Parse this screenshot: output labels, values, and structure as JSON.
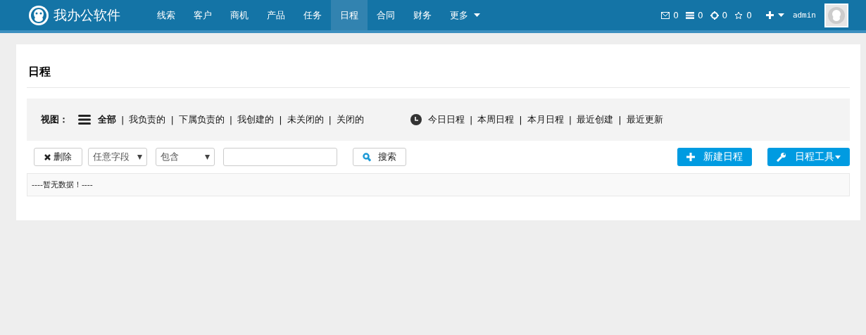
{
  "navbar": {
    "brand": "我办公软件",
    "items": [
      {
        "label": "线索",
        "selected": false
      },
      {
        "label": "客户",
        "selected": false
      },
      {
        "label": "商机",
        "selected": false
      },
      {
        "label": "产品",
        "selected": false
      },
      {
        "label": "任务",
        "selected": false
      },
      {
        "label": "日程",
        "selected": true
      },
      {
        "label": "合同",
        "selected": false
      },
      {
        "label": "财务",
        "selected": false
      },
      {
        "label": "更多",
        "selected": false,
        "dropdown": true
      }
    ],
    "counters": [
      {
        "kind": "mail",
        "count": "0"
      },
      {
        "kind": "list",
        "count": "0"
      },
      {
        "kind": "target",
        "count": "0"
      },
      {
        "kind": "star",
        "count": "0"
      }
    ],
    "user": "admin"
  },
  "page": {
    "title": "日程",
    "views": {
      "label": "视图：",
      "items": [
        {
          "kind": "link",
          "label": "全部",
          "selected": true
        },
        {
          "kind": "sep",
          "label": "|"
        },
        {
          "kind": "link",
          "label": "我负责的",
          "selected": false
        },
        {
          "kind": "sep",
          "label": "|"
        },
        {
          "kind": "link",
          "label": "下属负责的",
          "selected": false
        },
        {
          "kind": "sep",
          "label": "|"
        },
        {
          "kind": "link",
          "label": "我创建的",
          "selected": false
        },
        {
          "kind": "sep",
          "label": "|"
        },
        {
          "kind": "link",
          "label": "未关闭的",
          "selected": false
        },
        {
          "kind": "sep",
          "label": "|"
        },
        {
          "kind": "link",
          "label": "关闭的",
          "selected": false
        }
      ]
    },
    "time_views": [
      {
        "kind": "link",
        "label": "今日日程"
      },
      {
        "kind": "sep",
        "label": "|"
      },
      {
        "kind": "link",
        "label": "本周日程"
      },
      {
        "kind": "sep",
        "label": "|"
      },
      {
        "kind": "link",
        "label": "本月日程"
      },
      {
        "kind": "sep",
        "label": "|"
      },
      {
        "kind": "link",
        "label": "最近创建"
      },
      {
        "kind": "sep",
        "label": "|"
      },
      {
        "kind": "link",
        "label": "最近更新"
      }
    ],
    "toolbar": {
      "delete": "删除",
      "field_select": "任意字段",
      "condition_select": "包含",
      "search": "搜索",
      "new": "新建日程",
      "tools": "日程工具"
    },
    "empty_message": "----暂无数据！----"
  }
}
